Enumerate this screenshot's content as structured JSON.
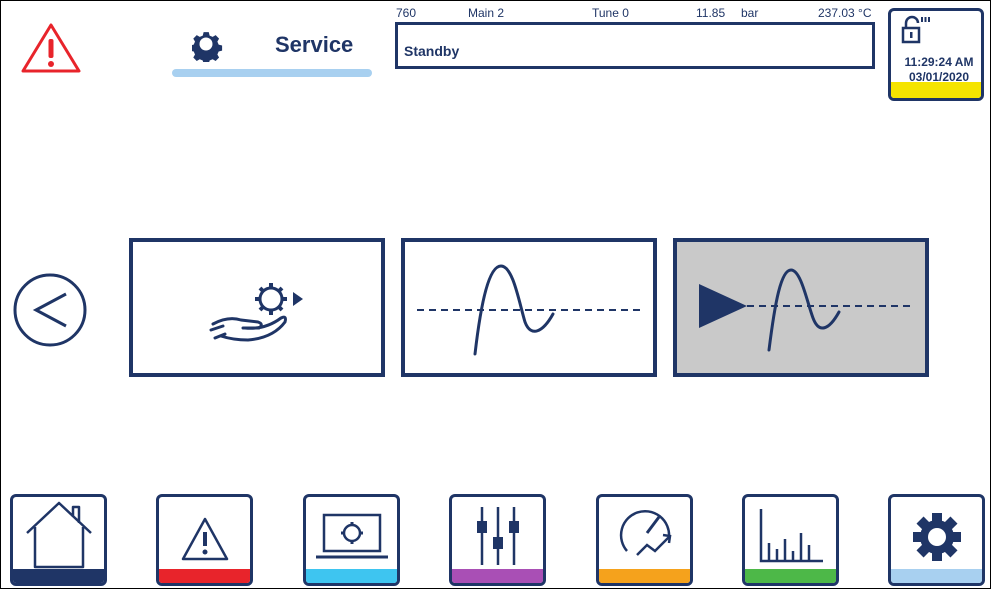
{
  "header": {
    "title": "Service",
    "status": {
      "code": "760",
      "main": "Main 2",
      "tune": "Tune 0",
      "pressure": "11.85",
      "pressure_unit": "bar",
      "temperature": "237.03 °C"
    },
    "status_text": "Standby",
    "time": "11:29:24 AM",
    "date": "03/01/2020"
  },
  "icons": {
    "alarm": "warning-icon",
    "service": "gear-icon",
    "lock": "unlocked-lock-icon",
    "back": "arrow-left-icon"
  },
  "tiles": [
    {
      "name": "service-hand-gear",
      "icon": "hand-gear-play-icon",
      "selected": false
    },
    {
      "name": "tune-curve",
      "icon": "step-response-curve-icon",
      "selected": false
    },
    {
      "name": "run-tune",
      "icon": "play-curve-icon",
      "selected": true
    }
  ],
  "nav": [
    {
      "name": "home",
      "icon": "home-icon",
      "color": "#1f3566"
    },
    {
      "name": "alarms",
      "icon": "warning-icon",
      "color": "#e8242b"
    },
    {
      "name": "monitor",
      "icon": "laptop-gear-icon",
      "color": "#3ec5f0"
    },
    {
      "name": "settings",
      "icon": "sliders-icon",
      "color": "#a94fb5"
    },
    {
      "name": "performance",
      "icon": "gauge-trend-icon",
      "color": "#f5a21c"
    },
    {
      "name": "charts",
      "icon": "bar-chart-icon",
      "color": "#4db848"
    },
    {
      "name": "service",
      "icon": "gear-icon",
      "color": "#a8d0f0"
    }
  ],
  "colors": {
    "navy": "#1f3566",
    "alarm_red": "#e8242b",
    "selected_tile": "#c9c9c9",
    "clock_strip": "#f5e400"
  }
}
